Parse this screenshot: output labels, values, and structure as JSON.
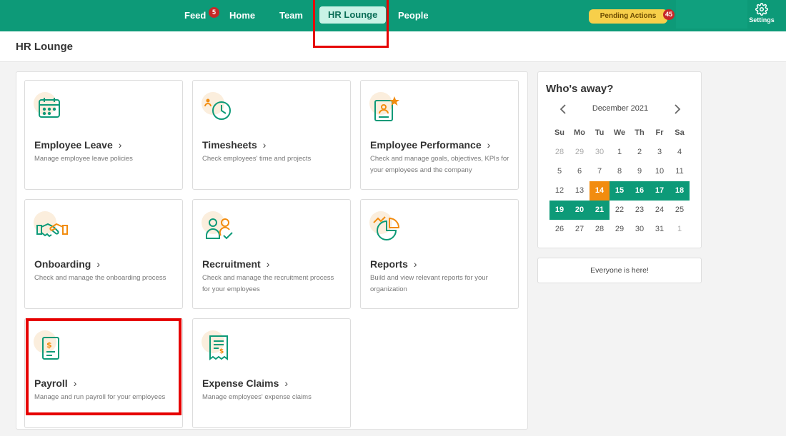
{
  "nav": {
    "feed": "Feed",
    "feed_badge": "5",
    "home": "Home",
    "team": "Team",
    "hr_lounge": "HR Lounge",
    "people": "People",
    "pending_actions": "Pending Actions",
    "pending_badge": "45",
    "settings": "Settings"
  },
  "page_title": "HR Lounge",
  "cards": [
    {
      "title": "Employee Leave",
      "desc": "Manage employee leave policies",
      "icon": "calendar-icon"
    },
    {
      "title": "Timesheets",
      "desc": "Check employees' time and projects",
      "icon": "clock-icon"
    },
    {
      "title": "Employee Performance",
      "desc": "Check and manage goals, objectives, KPIs for your employees and the company",
      "icon": "performance-icon"
    },
    {
      "title": "Onboarding",
      "desc": "Check and manage the onboarding process",
      "icon": "handshake-icon"
    },
    {
      "title": "Recruitment",
      "desc": "Check and manage the recruitment process for your employees",
      "icon": "people-check-icon"
    },
    {
      "title": "Reports",
      "desc": "Build and view relevant reports for your organization",
      "icon": "pie-chart-icon"
    },
    {
      "title": "Payroll",
      "desc": "Manage and run payroll for your employees",
      "icon": "payroll-icon"
    },
    {
      "title": "Expense Claims",
      "desc": "Manage employees' expense claims",
      "icon": "receipt-icon"
    }
  ],
  "away": {
    "title": "Who's away?",
    "month": "December 2021",
    "weekdays": [
      "Su",
      "Mo",
      "Tu",
      "We",
      "Th",
      "Fr",
      "Sa"
    ],
    "weeks": [
      [
        "28",
        "29",
        "30",
        "1",
        "2",
        "3",
        "4"
      ],
      [
        "5",
        "6",
        "7",
        "8",
        "9",
        "10",
        "11"
      ],
      [
        "12",
        "13",
        "14",
        "15",
        "16",
        "17",
        "18"
      ],
      [
        "19",
        "20",
        "21",
        "22",
        "23",
        "24",
        "25"
      ],
      [
        "26",
        "27",
        "28",
        "29",
        "30",
        "31",
        "1"
      ]
    ],
    "today": "14",
    "away_days": [
      "15",
      "16",
      "17",
      "18",
      "19",
      "20",
      "21"
    ],
    "status": "Everyone is here!"
  },
  "colors": {
    "brand": "#0d9a78",
    "accent_orange": "#f28c0f",
    "pending": "#f7cf4a",
    "badge": "#c62828",
    "highlight": "#e60000"
  }
}
